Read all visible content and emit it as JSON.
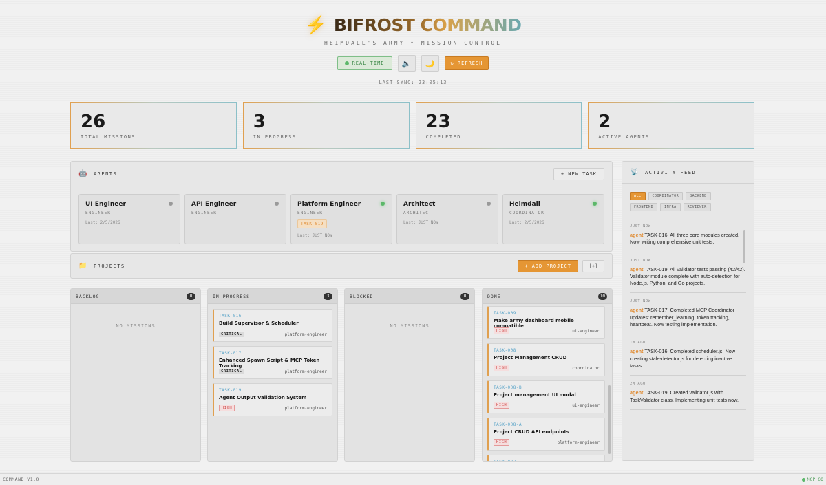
{
  "header": {
    "bolt_icon": "⚡",
    "title": "BIFROST COMMAND",
    "subtitle": "HEIMDALL'S ARMY • MISSION CONTROL",
    "realtime_label": "REAL-TIME",
    "sound_icon": "🔈",
    "theme_icon": "🌙",
    "refresh_label": "↻ REFRESH",
    "last_sync": "LAST SYNC: 23:05:13"
  },
  "stats": [
    {
      "value": "26",
      "label": "TOTAL MISSIONS"
    },
    {
      "value": "3",
      "label": "IN PROGRESS"
    },
    {
      "value": "23",
      "label": "COMPLETED"
    },
    {
      "value": "2",
      "label": "ACTIVE AGENTS"
    }
  ],
  "agents_panel": {
    "icon": "🤖",
    "title": "AGENTS",
    "new_task_label": "+ NEW TASK",
    "agents": [
      {
        "name": "UI Engineer",
        "role": "ENGINEER",
        "task": "",
        "last": "Last: 2/5/2026",
        "status": "offline"
      },
      {
        "name": "API Engineer",
        "role": "ENGINEER",
        "task": "",
        "last": "",
        "status": "offline"
      },
      {
        "name": "Platform Engineer",
        "role": "ENGINEER",
        "task": "TASK-019",
        "last": "Last: JUST NOW",
        "status": "online"
      },
      {
        "name": "Architect",
        "role": "ARCHITECT",
        "task": "",
        "last": "Last: JUST NOW",
        "status": "offline"
      },
      {
        "name": "Heimdall",
        "role": "COORDINATOR",
        "task": "",
        "last": "Last: 2/5/2026",
        "status": "online"
      }
    ]
  },
  "projects_panel": {
    "icon": "📁",
    "title": "PROJECTS",
    "add_label": "+ ADD PROJECT",
    "expand_label": "[+]"
  },
  "columns": {
    "backlog": {
      "title": "BACKLOG",
      "count": "0",
      "empty": "NO MISSIONS",
      "cards": []
    },
    "in_progress": {
      "title": "IN PROGRESS",
      "count": "3",
      "cards": [
        {
          "id": "TASK-016",
          "title": "Build Supervisor & Scheduler",
          "priority": "CRITICAL",
          "assignee": "platform-engineer"
        },
        {
          "id": "TASK-017",
          "title": "Enhanced Spawn Script & MCP Token Tracking",
          "priority": "CRITICAL",
          "assignee": "platform-engineer"
        },
        {
          "id": "TASK-019",
          "title": "Agent Output Validation System",
          "priority": "HIGH",
          "assignee": "platform-engineer"
        }
      ]
    },
    "blocked": {
      "title": "BLOCKED",
      "count": "0",
      "empty": "NO MISSIONS",
      "cards": []
    },
    "done": {
      "title": "DONE",
      "count": "10",
      "cards": [
        {
          "id": "TASK-009",
          "title": "Make army dashboard mobile compatible",
          "priority": "HIGH",
          "assignee": "ui-engineer"
        },
        {
          "id": "TASK-008",
          "title": "Project Management CRUD",
          "priority": "HIGH",
          "assignee": "coordinator"
        },
        {
          "id": "TASK-008-B",
          "title": "Project management UI modal",
          "priority": "HIGH",
          "assignee": "ui-engineer"
        },
        {
          "id": "TASK-008-A",
          "title": "Project CRUD API endpoints",
          "priority": "HIGH",
          "assignee": "platform-engineer"
        },
        {
          "id": "TASK-007",
          "title": "",
          "priority": "",
          "assignee": ""
        }
      ]
    }
  },
  "activity_feed": {
    "icon": "📡",
    "title": "ACTIVITY FEED",
    "filters": [
      {
        "label": "ALL",
        "active": true
      },
      {
        "label": "COORDINATOR",
        "active": false
      },
      {
        "label": "BACKEND",
        "active": false
      },
      {
        "label": "FRONTEND",
        "active": false
      },
      {
        "label": "INFRA",
        "active": false
      },
      {
        "label": "REVIEWER",
        "active": false
      }
    ],
    "items": [
      {
        "time": "JUST NOW",
        "agent": "agent",
        "text": "TASK-016: All three core modules created. Now writing comprehensive unit tests."
      },
      {
        "time": "JUST NOW",
        "agent": "agent",
        "text": "TASK-019: All validator tests passing (42/42). Validator module complete with auto-detection for Node.js, Python, and Go projects."
      },
      {
        "time": "JUST NOW",
        "agent": "agent",
        "text": "TASK-017: Completed MCP Coordinator updates: remember_learning, token tracking, heartbeat. Now testing implementation."
      },
      {
        "time": "1M AGO",
        "agent": "agent",
        "text": "TASK-016: Completed scheduler.js. Now creating stale-detector.js for detecting inactive tasks."
      },
      {
        "time": "2M AGO",
        "agent": "agent",
        "text": "TASK-019: Created validator.js with TaskValidator class. Implementing unit tests now."
      }
    ]
  },
  "footer": {
    "left": "COMMAND V1.0",
    "right": "MCP CO"
  },
  "colors": {
    "accent": "#e59634",
    "online": "#5cb86a",
    "task_id": "#5aa4c8",
    "high": "#d04848"
  }
}
